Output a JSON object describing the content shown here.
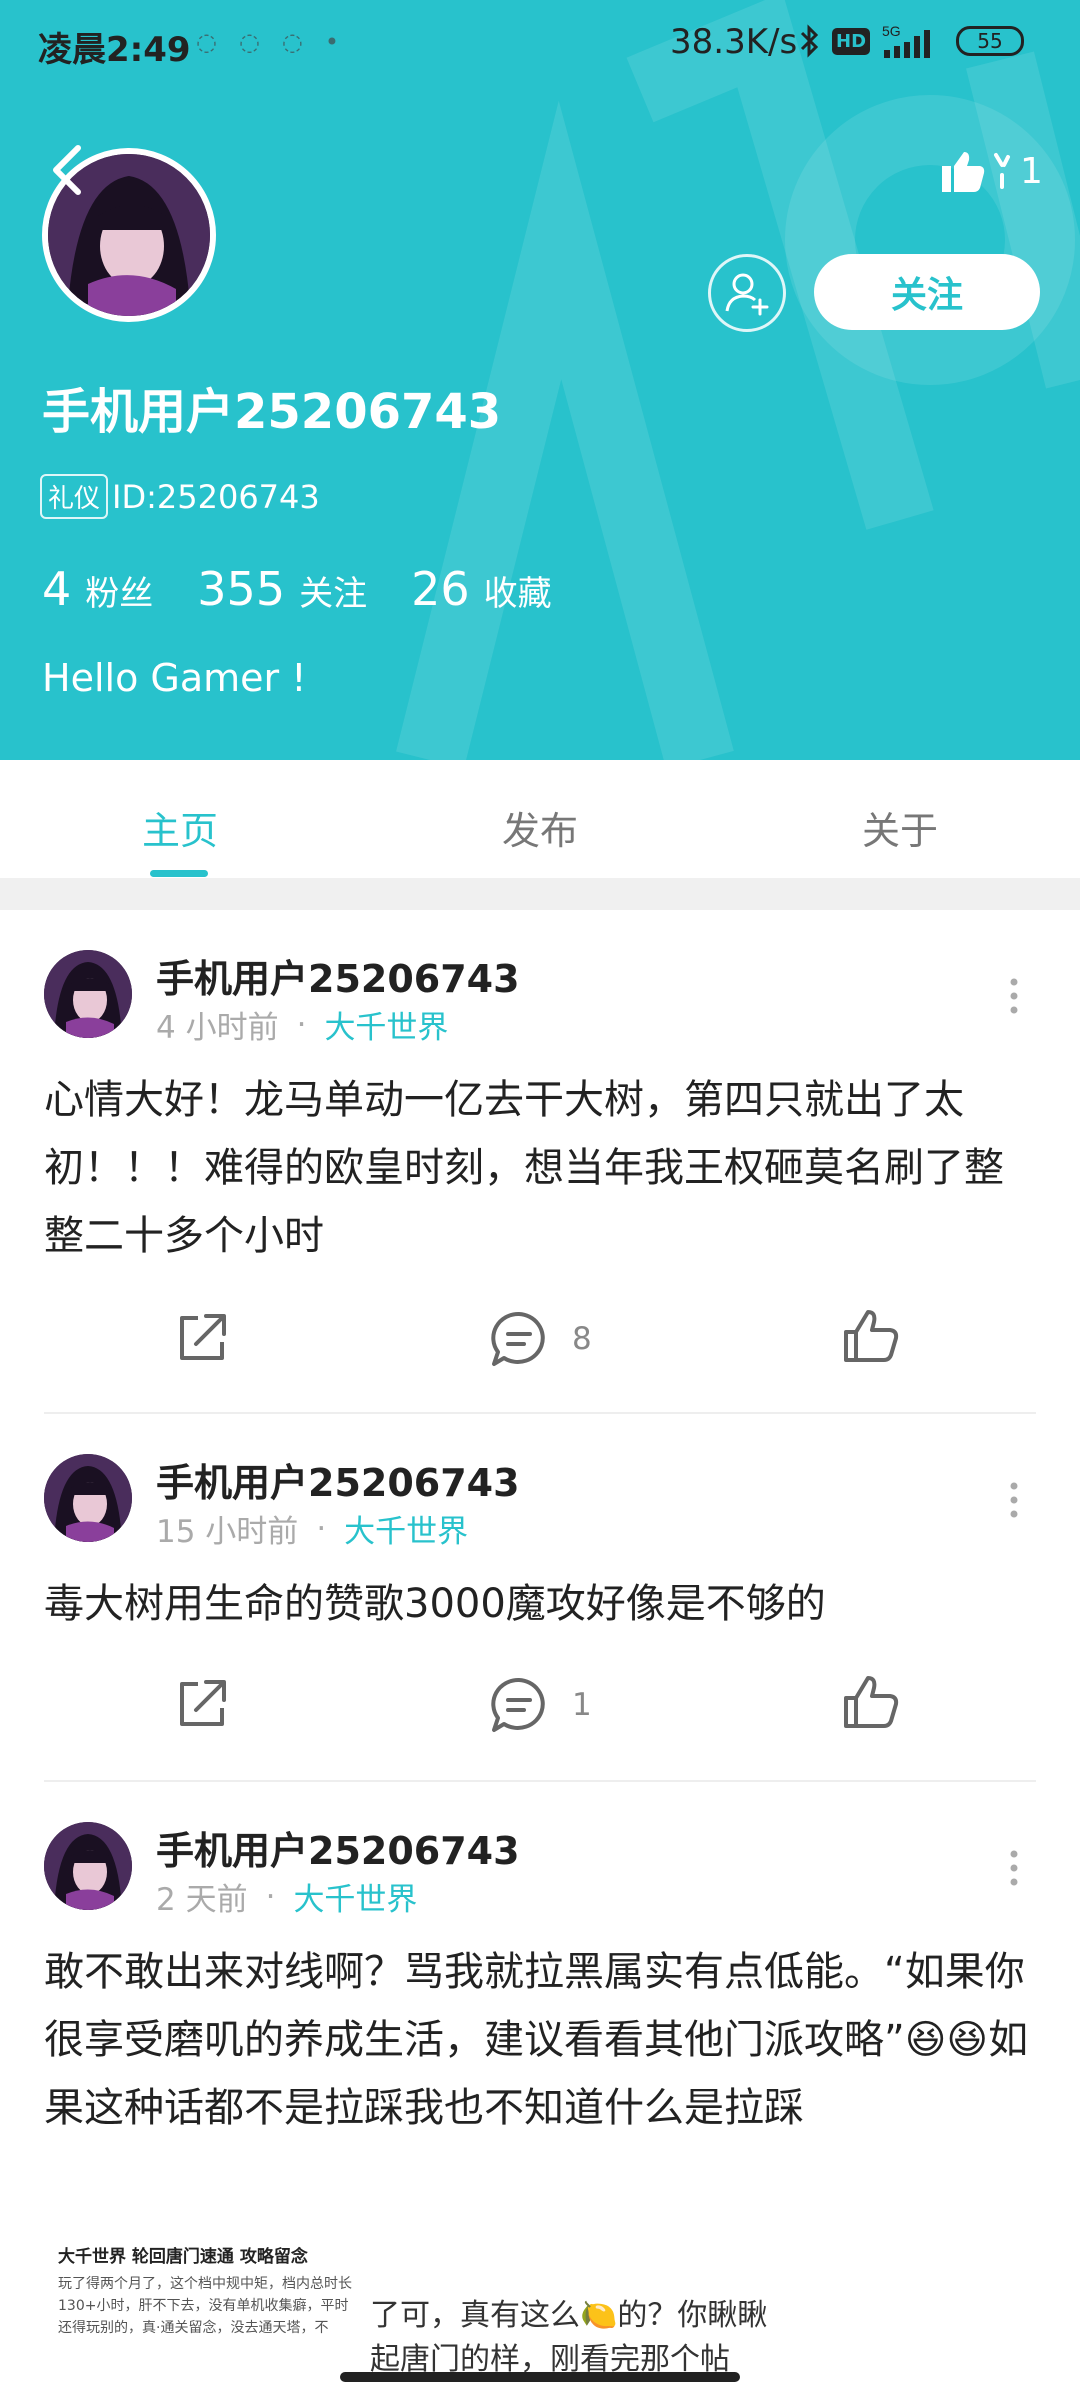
{
  "status_bar": {
    "time": "凌晨2:49",
    "network_speed": "38.3K/s",
    "hd_label": "HD",
    "signal_label": "5G",
    "battery": "55"
  },
  "profile": {
    "likes_count": "1",
    "follow_label": "关注",
    "username": "手机用户25206743",
    "badge": "礼仪",
    "user_id": "ID:25206743",
    "stats": [
      {
        "value": "4",
        "label": "粉丝"
      },
      {
        "value": "355",
        "label": "关注"
      },
      {
        "value": "26",
        "label": "收藏"
      }
    ],
    "bio": "Hello Gamer !"
  },
  "tabs": [
    {
      "label": "主页",
      "active": true
    },
    {
      "label": "发布",
      "active": false
    },
    {
      "label": "关于",
      "active": false
    }
  ],
  "posts": [
    {
      "author": "手机用户25206743",
      "time": "4 小时前",
      "forum": "大千世界",
      "content": "心情大好！龙马单动一亿去干大树，第四只就出了太初！！！难得的欧皇时刻，想当年我王权砸莫名刷了整整二十多个小时",
      "comments": "8"
    },
    {
      "author": "手机用户25206743",
      "time": "15 小时前",
      "forum": "大千世界",
      "content": "毒大树用生命的赞歌3000魔攻好像是不够的",
      "comments": "1"
    },
    {
      "author": "手机用户25206743",
      "time": "2 天前",
      "forum": "大千世界",
      "content": "敢不敢出来对线啊？骂我就拉黑属实有点低能。“如果你很享受磨叽的养成生活，建议看看其他门派攻略”😆😆如果这种话都不是拉踩我也不知道什么是拉踩",
      "comments": ""
    }
  ],
  "attachment": {
    "title": "大千世界 轮回唐门速通 攻略留念",
    "text": "玩了得两个月了，这个档中规中矩，档内总时长130+小时，肝不下去，没有单机收集癖，平时还得玩别的，真·通关留念，没去通天塔，不",
    "text2_line1": "了可，真有这么🍋的？你瞅瞅",
    "text2_line2": "起唐门的样，刚看完那个帖"
  },
  "colors": {
    "accent": "#28c2cc"
  }
}
